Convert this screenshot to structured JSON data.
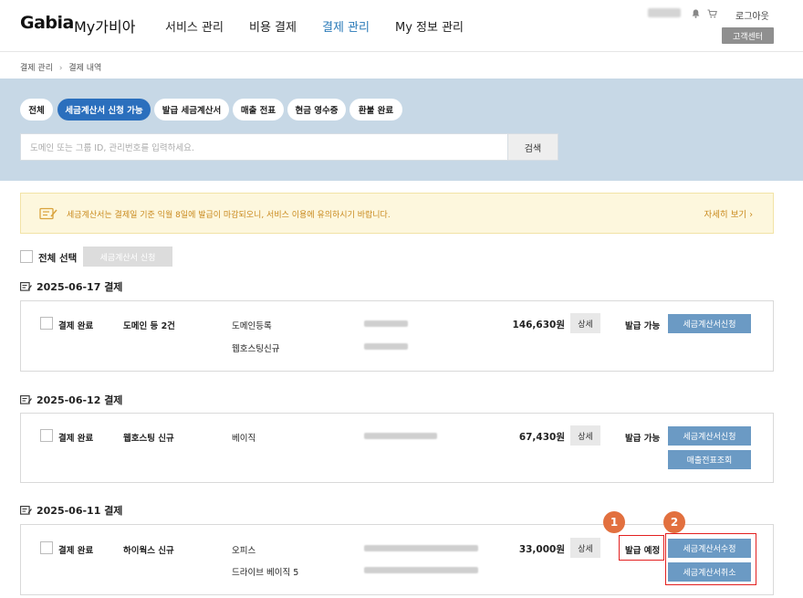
{
  "header": {
    "logo": "Gabia",
    "logo_sub": "My가비아",
    "nav": [
      {
        "label": "서비스 관리"
      },
      {
        "label": "비용 결제"
      },
      {
        "label": "결제 관리",
        "active": true
      },
      {
        "label": "My 정보 관리"
      }
    ],
    "logout": "로그아웃",
    "customer_center": "고객센터"
  },
  "breadcrumb": [
    "결제 관리",
    "결제 내역"
  ],
  "tabs": [
    {
      "label": "전체"
    },
    {
      "label": "세금계산서 신청 가능",
      "active": true
    },
    {
      "label": "발급 세금계산서"
    },
    {
      "label": "매출 전표"
    },
    {
      "label": "현금 영수증"
    },
    {
      "label": "환불 완료"
    }
  ],
  "search": {
    "placeholder": "도메인 또는 그룹 ID, 관리번호를 입력하세요.",
    "button": "검색"
  },
  "notice": {
    "text": "세금계산서는 결제일 기준 익월 8일에 발급이 마감되오니, 서비스 이용에 유의하시기 바랍니다.",
    "more": "자세히 보기 ›"
  },
  "select_all": {
    "label": "전체 선택",
    "apply_button": "세금계산서 신청"
  },
  "groups": [
    {
      "date_title": "2025-06-17 결제",
      "status": "결제 완료",
      "product": "도메인 등 2건",
      "items": [
        "도메인등록",
        "웹호스팅신규"
      ],
      "amount": "146,630원",
      "detail": "상세",
      "issue_status": "발급 가능",
      "buttons": [
        "세금계산서신청"
      ]
    },
    {
      "date_title": "2025-06-12 결제",
      "status": "결제 완료",
      "product": "웹호스팅 신규",
      "items": [
        "베이직"
      ],
      "amount": "67,430원",
      "detail": "상세",
      "issue_status": "발급 가능",
      "buttons": [
        "세금계산서신청",
        "매출전표조회"
      ]
    },
    {
      "date_title": "2025-06-11 결제",
      "status": "결제 완료",
      "product": "하이웍스 신규",
      "items": [
        "오피스",
        "드라이브 베이직 5"
      ],
      "amount": "33,000원",
      "detail": "상세",
      "issue_status": "발급 예정",
      "buttons": [
        "세금계산서수정",
        "세금계산서취소"
      ]
    }
  ],
  "annotations": [
    "1",
    "2"
  ],
  "colors": {
    "accent": "#2b6fbd",
    "band": "#c7d8e6",
    "button_blue": "#6b9ac4",
    "highlight_red": "#e32020",
    "marker_orange": "#e2703f"
  }
}
